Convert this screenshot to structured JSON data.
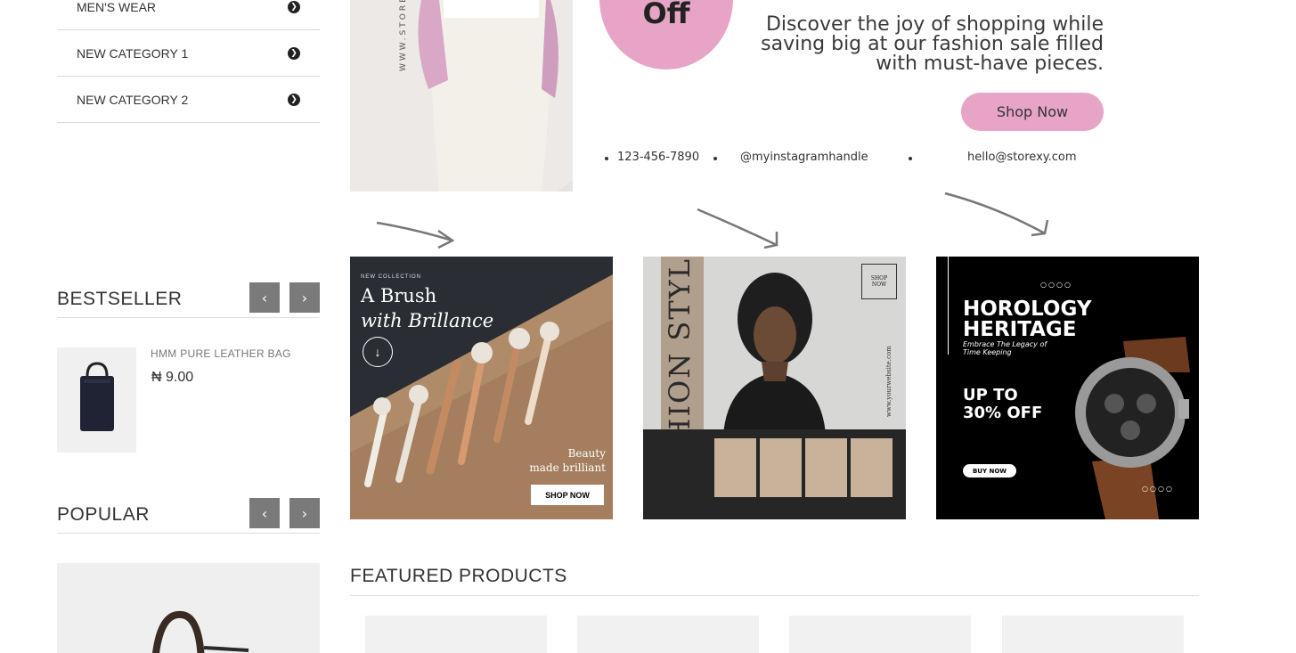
{
  "categories": [
    {
      "label": "MEN'S WEAR"
    },
    {
      "label": "NEW CATEGORY 1"
    },
    {
      "label": "NEW CATEGORY 2"
    }
  ],
  "bestseller": {
    "title": "BESTSELLER",
    "product_name": "HMM PURE LEATHER BAG",
    "product_price": "₦ 9.00"
  },
  "popular": {
    "title": "POPULAR"
  },
  "hero": {
    "off_text": "Off",
    "tagline_line1": "Discover the joy of shopping while",
    "tagline_line2": "saving big at our fashion sale filled",
    "tagline_line3": "with must-have pieces.",
    "shop_now": "Shop Now",
    "phone": "123-456-7890",
    "instagram": "@myinstagramhandle",
    "email": "hello@storexy.com",
    "side_text": "WWW.STORE"
  },
  "promo_tiles": {
    "brush": {
      "small_label": "NEW COLLECTION",
      "title_line1": "A Brush",
      "title_line2": "with Brillance",
      "beauty_line1": "Beauty",
      "beauty_line2": "made brilliant",
      "shop_now": "SHOP NOW"
    },
    "fashion": {
      "vertical_title": "FASHION STYLE",
      "shop_box_line1": "SHOP",
      "shop_box_line2": "NOW",
      "site": "www.yourwebsite.com"
    },
    "horology": {
      "dots": "○○○○",
      "title_line1": "HOROLOGY",
      "title_line2": "HERITAGE",
      "sub_line1": "Embrace The Legacy of",
      "sub_line2": "Time Keeping",
      "offer_line1": "UP TO",
      "offer_line2": "30% OFF",
      "buy_now": "BUY NOW"
    }
  },
  "featured": {
    "title": "FEATURED PRODUCTS"
  },
  "colors": {
    "accent_pink": "#e7a4c6",
    "nav_button": "#7a7a7a"
  },
  "icons": {
    "category_arrow": "chevron-circle-right-icon",
    "carousel_prev": "chevron-left-icon",
    "carousel_next": "chevron-right-icon"
  }
}
